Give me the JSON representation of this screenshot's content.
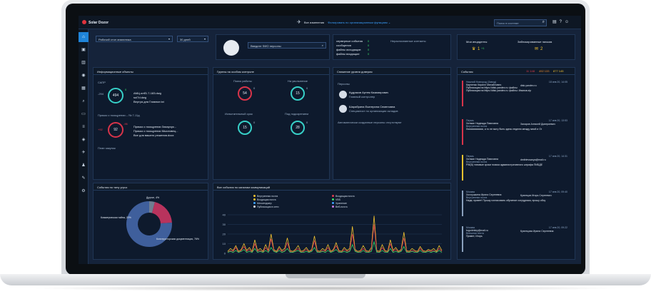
{
  "app": {
    "title": "Solar Dozor"
  },
  "topbar": {
    "nav_all": "Все изменения",
    "nav_filter": "Фильтровать по организационным функциям ⌄",
    "search_placeholder": "Поиск в системе"
  },
  "filters": {
    "dashboard": "Рабочий стол аналитика",
    "period": "30 дней"
  },
  "person_search": {
    "placeholder": "Введите ФИО персоны"
  },
  "summary": {
    "rows": [
      "серверные события",
      "сообщения",
      "файлы исходящие",
      "файлы входящие"
    ],
    "values": [
      "0",
      "0",
      "0",
      "0"
    ],
    "contacts_label": "Нераспознанные контакты"
  },
  "incidents": {
    "label": "Мои инциденты",
    "value": "1",
    "delta": "+1"
  },
  "blocked": {
    "label": "Заблокированные письма",
    "value": "2"
  },
  "info_objects": {
    "title": "Информационные объекты",
    "sapr": {
      "label": "САПР",
      "value": "494",
      "delta_left": "-294",
      "delta_right": "0",
      "files": [
        "АМЦ-элб1.7-183.dwg",
        "sol7d.dwg",
        "Вертуа для Главное.txt"
      ]
    },
    "order": {
      "label": "Приказ о поощрении – № 7-11д",
      "value": "92",
      "delta_left": "+92",
      "delta_right": "-96",
      "files": [
        "Приказ о поощрении Захарчук...",
        "Приказ о поощрении Мысливец...",
        "Все для вашего решения.docx"
      ]
    },
    "purchase": "План закупок"
  },
  "control_groups": {
    "title": "Группы на особом контроле",
    "items": [
      {
        "label": "Поиск работы",
        "value": "54",
        "delta": "0"
      },
      {
        "label": "На увольнение",
        "value": "15",
        "delta": "0"
      },
      {
        "label": "Испытательный срок",
        "value": "15",
        "delta": "0"
      },
      {
        "label": "Под подозрением",
        "value": "28",
        "delta": "0"
      }
    ]
  },
  "trust": {
    "title": "Снижение уровня доверия",
    "section": "Персоны",
    "people": [
      {
        "name": "Кудряков Артем Казимирович",
        "role": "Главный контролер"
      },
      {
        "name": "Шарабрина Екатерина Семеновна",
        "role": "Специалист по организации складов"
      }
    ],
    "auto": "Автоматически созданные персоны отсутствуют"
  },
  "events": {
    "title": "События",
    "badges": {
      "red": "11 148",
      "orange": "492 133",
      "yellow": "877 145"
    },
    "messages": [
      {
        "from": "Нижний Новгород (Завод)",
        "date": "18 янв 20, 14:05",
        "sender": "Карпенко Кирилл Михайлович",
        "to": "disk.yandex.ru",
        "note": "Публикация на https://disk.yandex.ru: файлы",
        "text": "Публикация на https://disk.yandex.ru: файлы: Иванов.zip"
      },
      {
        "from": "Пермь",
        "date": "17 янв 20, 13:53",
        "sender": "Хитман Надежда Павловна",
        "to": "Захаров Алексей Дмитриевич",
        "note": "Внутренняя почта",
        "text": "Лиииииииииии, а то не могу быть здесь неделю между мной и Ог"
      },
      {
        "from": "Пермь",
        "date": "17 янв 20, 14:31",
        "sender": "Хитман Надежда Павловна",
        "to": "dmitrievsanya@mail.ru",
        "note": "Внутренняя почта",
        "text": "FW(А) типовые сроки поиска административного штрафа ПИБДЕ"
      },
      {
        "from": "Москва",
        "date": "17 янв 20, 09:40",
        "sender": "Хохлушкина Ирина Сергеевна",
        "to": "Кузнецов Игорь Сергеевич",
        "note": "Внутренняя почта",
        "text": "Надя, привет! Прошу согласовать обучение сотрудника, прошу обсу"
      },
      {
        "from": "Москва",
        "date": "17 янв 20, 09:22",
        "sender": "togorielsky@mail.ru",
        "to": "Кузнецова Ирина Сергеевна",
        "note": "Внешняя почта",
        "text": "Привет, Игорь"
      }
    ]
  },
  "threats": {
    "title": "События по типу угроз",
    "slices": [
      {
        "label": "Другое",
        "value": 4,
        "color": "#6f7e91"
      },
      {
        "label": "Коммерческая тайна",
        "value": 20,
        "color": "#b8335d"
      },
      {
        "label": "Конструкторская документация",
        "value": 76,
        "color": "#3f5f9c"
      }
    ],
    "texts": [
      "Другое, 4%",
      "Коммерческая тайна, 20%",
      "Конструкторская документация, 76%"
    ]
  },
  "channels": {
    "title": "Все события по каналам коммуникаций",
    "legend": [
      {
        "label": "Внутренняя почта",
        "color": "#f2c230"
      },
      {
        "label": "Входящая почта",
        "color": "#e03b4d"
      },
      {
        "label": "Входящая почта",
        "color": "#f2c230"
      },
      {
        "label": "VBS",
        "color": "#3adf67"
      },
      {
        "label": "Мессенджер",
        "color": "#3aa0ff"
      },
      {
        "label": "Хранение",
        "color": "#3aa0ff"
      },
      {
        "label": "Публикация в сети",
        "color": "#e8e8e8"
      },
      {
        "label": "Веб-почта",
        "color": "#c77be8"
      }
    ]
  },
  "chart_data": {
    "type": "line",
    "title": "Все события по каналам коммуникаций",
    "ylim": [
      0,
      40
    ],
    "yticks": [
      0,
      10,
      20,
      30,
      40
    ],
    "series": [
      {
        "name": "Внутренняя почта",
        "color": "#f2c230",
        "values": [
          2,
          5,
          3,
          8,
          2,
          4,
          10,
          3,
          6,
          2,
          14,
          3,
          5,
          2,
          9,
          3,
          20,
          4,
          2,
          7,
          3,
          5,
          16,
          3,
          2,
          4,
          8,
          2,
          3,
          6,
          2,
          4,
          18,
          3,
          2,
          5,
          3,
          9,
          2,
          4,
          11,
          3,
          2,
          6,
          3,
          5,
          28,
          4,
          2,
          3,
          8,
          3,
          2,
          6,
          39,
          3,
          2,
          9,
          3,
          2,
          14,
          3,
          6,
          2,
          4,
          22,
          3,
          2,
          5,
          3,
          2,
          7,
          3,
          2,
          4,
          3,
          5,
          2,
          8,
          3
        ]
      },
      {
        "name": "Входящая почта",
        "color": "#e03b4d",
        "values": [
          1,
          3,
          2,
          6,
          1,
          3,
          7,
          2,
          4,
          1,
          10,
          2,
          3,
          1,
          6,
          2,
          15,
          3,
          1,
          5,
          2,
          3,
          11,
          2,
          1,
          3,
          5,
          1,
          2,
          4,
          1,
          3,
          13,
          2,
          1,
          3,
          2,
          6,
          1,
          3,
          8,
          2,
          1,
          4,
          2,
          3,
          20,
          3,
          1,
          2,
          5,
          2,
          1,
          4,
          30,
          2,
          1,
          6,
          2,
          1,
          10,
          2,
          4,
          1,
          3,
          16,
          2,
          1,
          3,
          2,
          1,
          5,
          2,
          1,
          3,
          2,
          3,
          1,
          5,
          2
        ]
      },
      {
        "name": "VBS",
        "color": "#3adf67",
        "values": [
          1,
          2,
          1,
          3,
          1,
          2,
          4,
          1,
          2,
          1,
          5,
          1,
          2,
          1,
          3,
          1,
          6,
          2,
          1,
          3,
          1,
          2,
          5,
          1,
          1,
          2,
          3,
          1,
          1,
          2,
          1,
          2,
          6,
          1,
          1,
          2,
          1,
          3,
          1,
          2,
          4,
          1,
          1,
          2,
          1,
          2,
          9,
          2,
          1,
          1,
          3,
          1,
          1,
          2,
          12,
          1,
          1,
          3,
          1,
          1,
          5,
          1,
          2,
          1,
          2,
          7,
          1,
          1,
          2,
          1,
          1,
          3,
          1,
          1,
          2,
          1,
          2,
          1,
          3,
          1
        ]
      }
    ]
  }
}
